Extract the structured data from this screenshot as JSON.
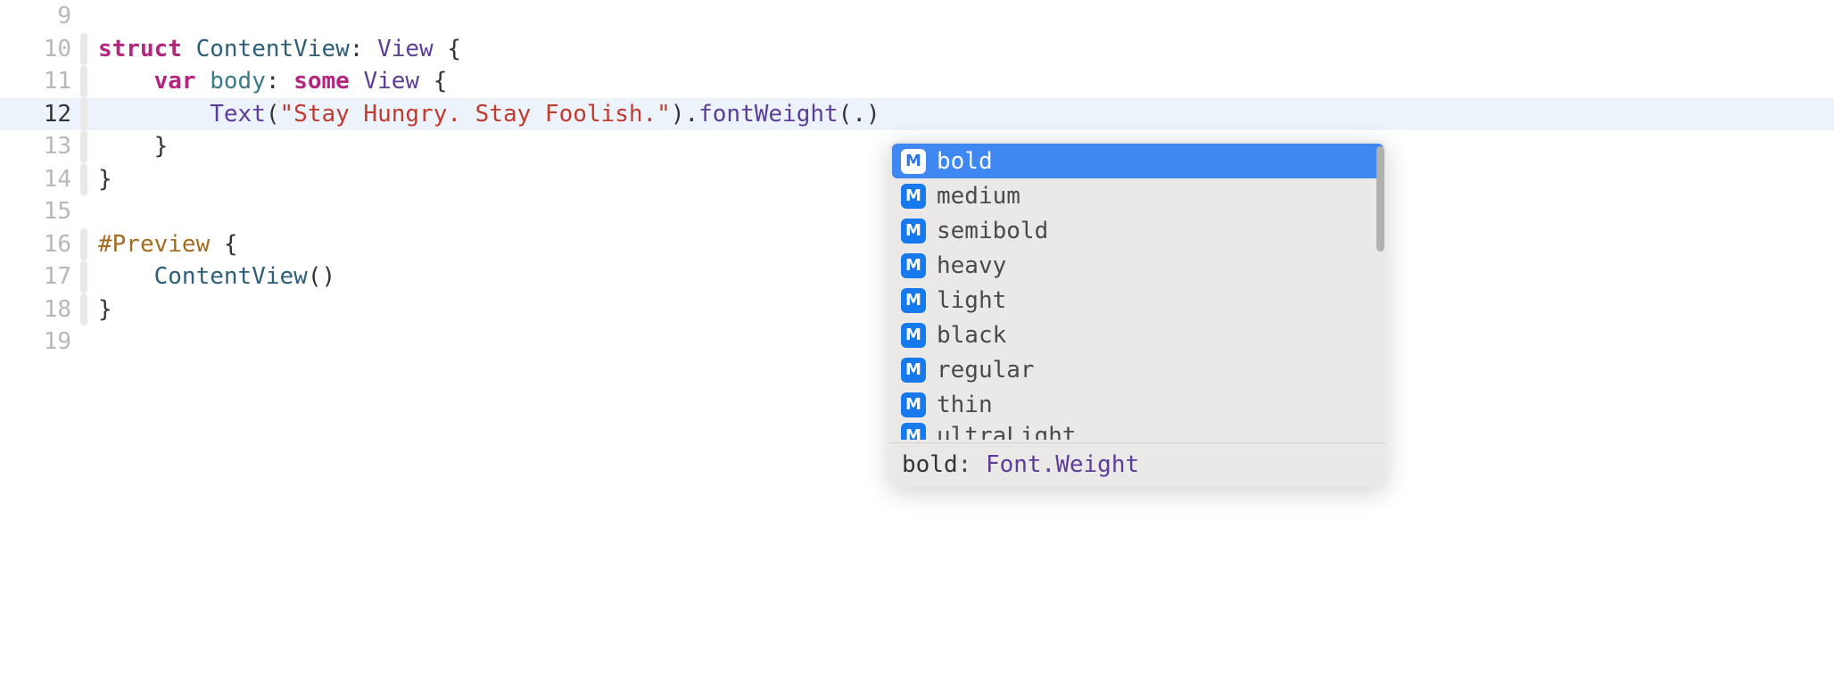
{
  "lines": {
    "9": {
      "num": "9",
      "content": ""
    },
    "10": {
      "num": "10",
      "indent": "",
      "tokens": [
        {
          "t": "struct",
          "c": "kw-struct"
        },
        {
          "t": " ",
          "c": ""
        },
        {
          "t": "ContentView",
          "c": "type-name"
        },
        {
          "t": ": ",
          "c": "brace"
        },
        {
          "t": "View",
          "c": "protocol"
        },
        {
          "t": " {",
          "c": "brace"
        }
      ]
    },
    "11": {
      "num": "11",
      "indent": "    ",
      "tokens": [
        {
          "t": "var",
          "c": "kw-var"
        },
        {
          "t": " ",
          "c": ""
        },
        {
          "t": "body",
          "c": "member"
        },
        {
          "t": ": ",
          "c": "brace"
        },
        {
          "t": "some",
          "c": "kw-some"
        },
        {
          "t": " ",
          "c": ""
        },
        {
          "t": "View",
          "c": "protocol"
        },
        {
          "t": " {",
          "c": "brace"
        }
      ]
    },
    "12": {
      "num": "12",
      "indent": "        ",
      "tokens": [
        {
          "t": "Text",
          "c": "protocol"
        },
        {
          "t": "(",
          "c": "paren"
        },
        {
          "t": "\"Stay Hungry. Stay Foolish.\"",
          "c": "string"
        },
        {
          "t": ")",
          "c": "paren"
        },
        {
          "t": ".",
          "c": "dot"
        },
        {
          "t": "fontWeight",
          "c": "method"
        },
        {
          "t": "(.)",
          "c": "paren"
        }
      ]
    },
    "13": {
      "num": "13",
      "indent": "    ",
      "tokens": [
        {
          "t": "}",
          "c": "brace"
        }
      ]
    },
    "14": {
      "num": "14",
      "indent": "",
      "tokens": [
        {
          "t": "}",
          "c": "brace"
        }
      ]
    },
    "15": {
      "num": "15",
      "content": ""
    },
    "16": {
      "num": "16",
      "indent": "",
      "tokens": [
        {
          "t": "#Preview",
          "c": "preview-macro"
        },
        {
          "t": " {",
          "c": "brace"
        }
      ]
    },
    "17": {
      "num": "17",
      "indent": "    ",
      "tokens": [
        {
          "t": "ContentView",
          "c": "type-name"
        },
        {
          "t": "()",
          "c": "paren"
        }
      ]
    },
    "18": {
      "num": "18",
      "indent": "",
      "tokens": [
        {
          "t": "}",
          "c": "brace"
        }
      ]
    },
    "19": {
      "num": "19",
      "content": ""
    }
  },
  "autocomplete": {
    "badge": "M",
    "items": [
      {
        "label": "bold",
        "selected": true
      },
      {
        "label": "medium",
        "selected": false
      },
      {
        "label": "semibold",
        "selected": false
      },
      {
        "label": "heavy",
        "selected": false
      },
      {
        "label": "light",
        "selected": false
      },
      {
        "label": "black",
        "selected": false
      },
      {
        "label": "regular",
        "selected": false
      },
      {
        "label": "thin",
        "selected": false
      },
      {
        "label": "ultraLight",
        "selected": false,
        "partial": true
      }
    ],
    "footer": {
      "name": "bold",
      "sep": ": ",
      "type": "Font.Weight"
    }
  }
}
